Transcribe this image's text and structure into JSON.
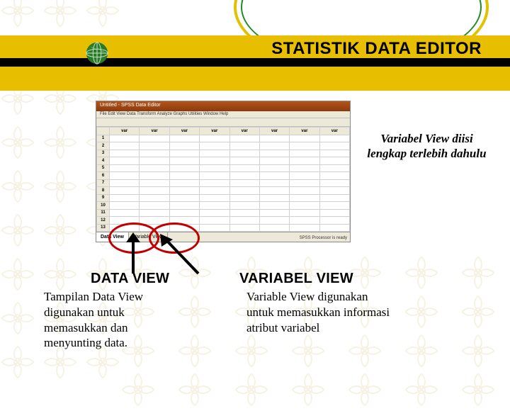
{
  "title": "STATISTIK DATA EDITOR",
  "screenshot": {
    "window_title": "Untitled - SPSS Data Editor",
    "menubar": "File  Edit  View  Data  Transform  Analyze  Graphs  Utilities  Window  Help",
    "tab_data": "Data View",
    "tab_var": "Variable View",
    "status": "SPSS Processor is ready"
  },
  "caption_right": "Variabel View diisi lengkap terlebih dahulu",
  "columns": {
    "data": {
      "heading": "DATA  VIEW",
      "body": "Tampilan Data View digunakan untuk memasukkan dan menyunting data."
    },
    "variable": {
      "heading": "VARIABEL  VIEW",
      "body": "Variable View digunakan untuk memasukkan informasi atribut variabel"
    }
  }
}
